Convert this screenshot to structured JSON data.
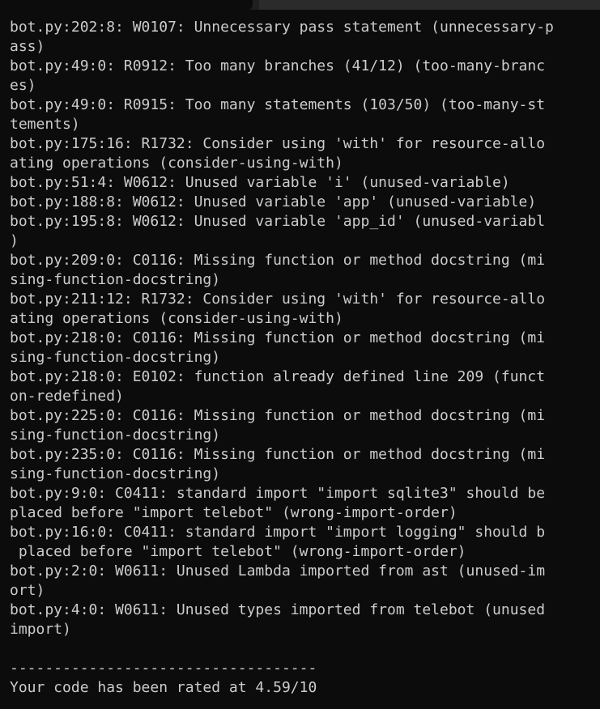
{
  "terminal": {
    "lines": [
      "bot.py:202:8: W0107: Unnecessary pass statement (unnecessary-p",
      "ass)",
      "bot.py:49:0: R0912: Too many branches (41/12) (too-many-branc",
      "es)",
      "bot.py:49:0: R0915: Too many statements (103/50) (too-many-st",
      "tements)",
      "bot.py:175:16: R1732: Consider using 'with' for resource-allo",
      "ating operations (consider-using-with)",
      "bot.py:51:4: W0612: Unused variable 'i' (unused-variable)",
      "bot.py:188:8: W0612: Unused variable 'app' (unused-variable)",
      "bot.py:195:8: W0612: Unused variable 'app_id' (unused-variabl",
      ")",
      "bot.py:209:0: C0116: Missing function or method docstring (mi",
      "sing-function-docstring)",
      "bot.py:211:12: R1732: Consider using 'with' for resource-allo",
      "ating operations (consider-using-with)",
      "bot.py:218:0: C0116: Missing function or method docstring (mi",
      "sing-function-docstring)",
      "bot.py:218:0: E0102: function already defined line 209 (funct",
      "on-redefined)",
      "bot.py:225:0: C0116: Missing function or method docstring (mi",
      "sing-function-docstring)",
      "bot.py:235:0: C0116: Missing function or method docstring (mi",
      "sing-function-docstring)",
      "bot.py:9:0: C0411: standard import \"import sqlite3\" should be",
      "placed before \"import telebot\" (wrong-import-order)",
      "bot.py:16:0: C0411: standard import \"import logging\" should b",
      " placed before \"import telebot\" (wrong-import-order)",
      "bot.py:2:0: W0611: Unused Lambda imported from ast (unused-im",
      "ort)",
      "bot.py:4:0: W0611: Unused types imported from telebot (unused",
      "import)",
      "",
      "-----------------------------------",
      "Your code has been rated at 4.59/10"
    ]
  }
}
